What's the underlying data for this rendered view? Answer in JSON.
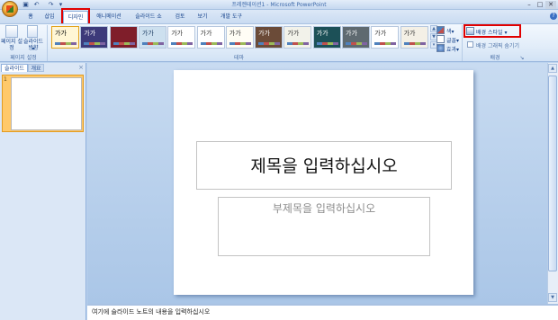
{
  "titlebar": {
    "title": "프레젠테이션1 - Microsoft PowerPoint",
    "qat": [
      "save-icon",
      "undo-icon",
      "redo-icon",
      "customize-icon"
    ],
    "qat_glyphs": [
      "▣",
      "↶",
      "↷",
      "▾"
    ],
    "controls": [
      "–",
      "□",
      "✕"
    ]
  },
  "tabs": [
    {
      "label": "홈"
    },
    {
      "label": "삽입"
    },
    {
      "label": "디자인",
      "active": true
    },
    {
      "label": "애니메이션"
    },
    {
      "label": "슬라이드 쇼"
    },
    {
      "label": "검토"
    },
    {
      "label": "보기"
    },
    {
      "label": "개발 도구"
    }
  ],
  "ribbon": {
    "page_setup": {
      "page_setup_btn": "페이지 설정",
      "orientation_btn": "슬라이드 방향",
      "orientation_arrow": "▾",
      "group_label": "페이지 설정"
    },
    "themes": {
      "items": [
        {
          "text": "가가",
          "bg": "#ffffff",
          "fg": "#000000"
        },
        {
          "text": "가가",
          "bg": "#3d3a7a",
          "fg": "#ffffff"
        },
        {
          "text": "",
          "bg": "#7f1e2a",
          "fg": "#ffffff"
        },
        {
          "text": "가가",
          "bg": "#cde0ef",
          "fg": "#1f3f66"
        },
        {
          "text": "가가",
          "bg": "#ffffff",
          "fg": "#333333"
        },
        {
          "text": "가가",
          "bg": "#ffffff",
          "fg": "#333333"
        },
        {
          "text": "가가",
          "bg": "#fffdf5",
          "fg": "#333333"
        },
        {
          "text": "가가",
          "bg": "#6b4b38",
          "fg": "#ffffff"
        },
        {
          "text": "가가",
          "bg": "#f2f2ea",
          "fg": "#333333"
        },
        {
          "text": "가가",
          "bg": "#1c5057",
          "fg": "#ffffff"
        },
        {
          "text": "가가",
          "bg": "#5f6a70",
          "fg": "#ffffff"
        },
        {
          "text": "가가",
          "bg": "#ffffff",
          "fg": "#333333"
        },
        {
          "text": "가가",
          "bg": "#f4f0e6",
          "fg": "#333333"
        }
      ],
      "group_label": "테마",
      "arrows": [
        "▲",
        "▼",
        "▾"
      ]
    },
    "theme_options": {
      "colors": "색",
      "fonts": "글꼴",
      "effects": "효과",
      "arrow": "▾"
    },
    "background": {
      "styles_btn": "배경 스타일",
      "styles_arrow": "▾",
      "hide_graphics": "배경 그래픽 숨기기",
      "group_label": "배경",
      "launcher": "↘"
    }
  },
  "left_pane": {
    "tabs": [
      "슬라이드",
      "개요"
    ],
    "close": "×",
    "slide_number": "1"
  },
  "slide": {
    "title_placeholder": "제목을 입력하십시오",
    "subtitle_placeholder": "부제목을 입력하십시오"
  },
  "notes": {
    "placeholder": "여기에 슬라이드 노트의 내용을 입력하십시오"
  },
  "scrollbar": {
    "up": "▲",
    "down": "▼"
  },
  "colors": {
    "highlight": "#e00000",
    "ribbon_text": "#15428b",
    "work_area": "#aac6e7"
  }
}
